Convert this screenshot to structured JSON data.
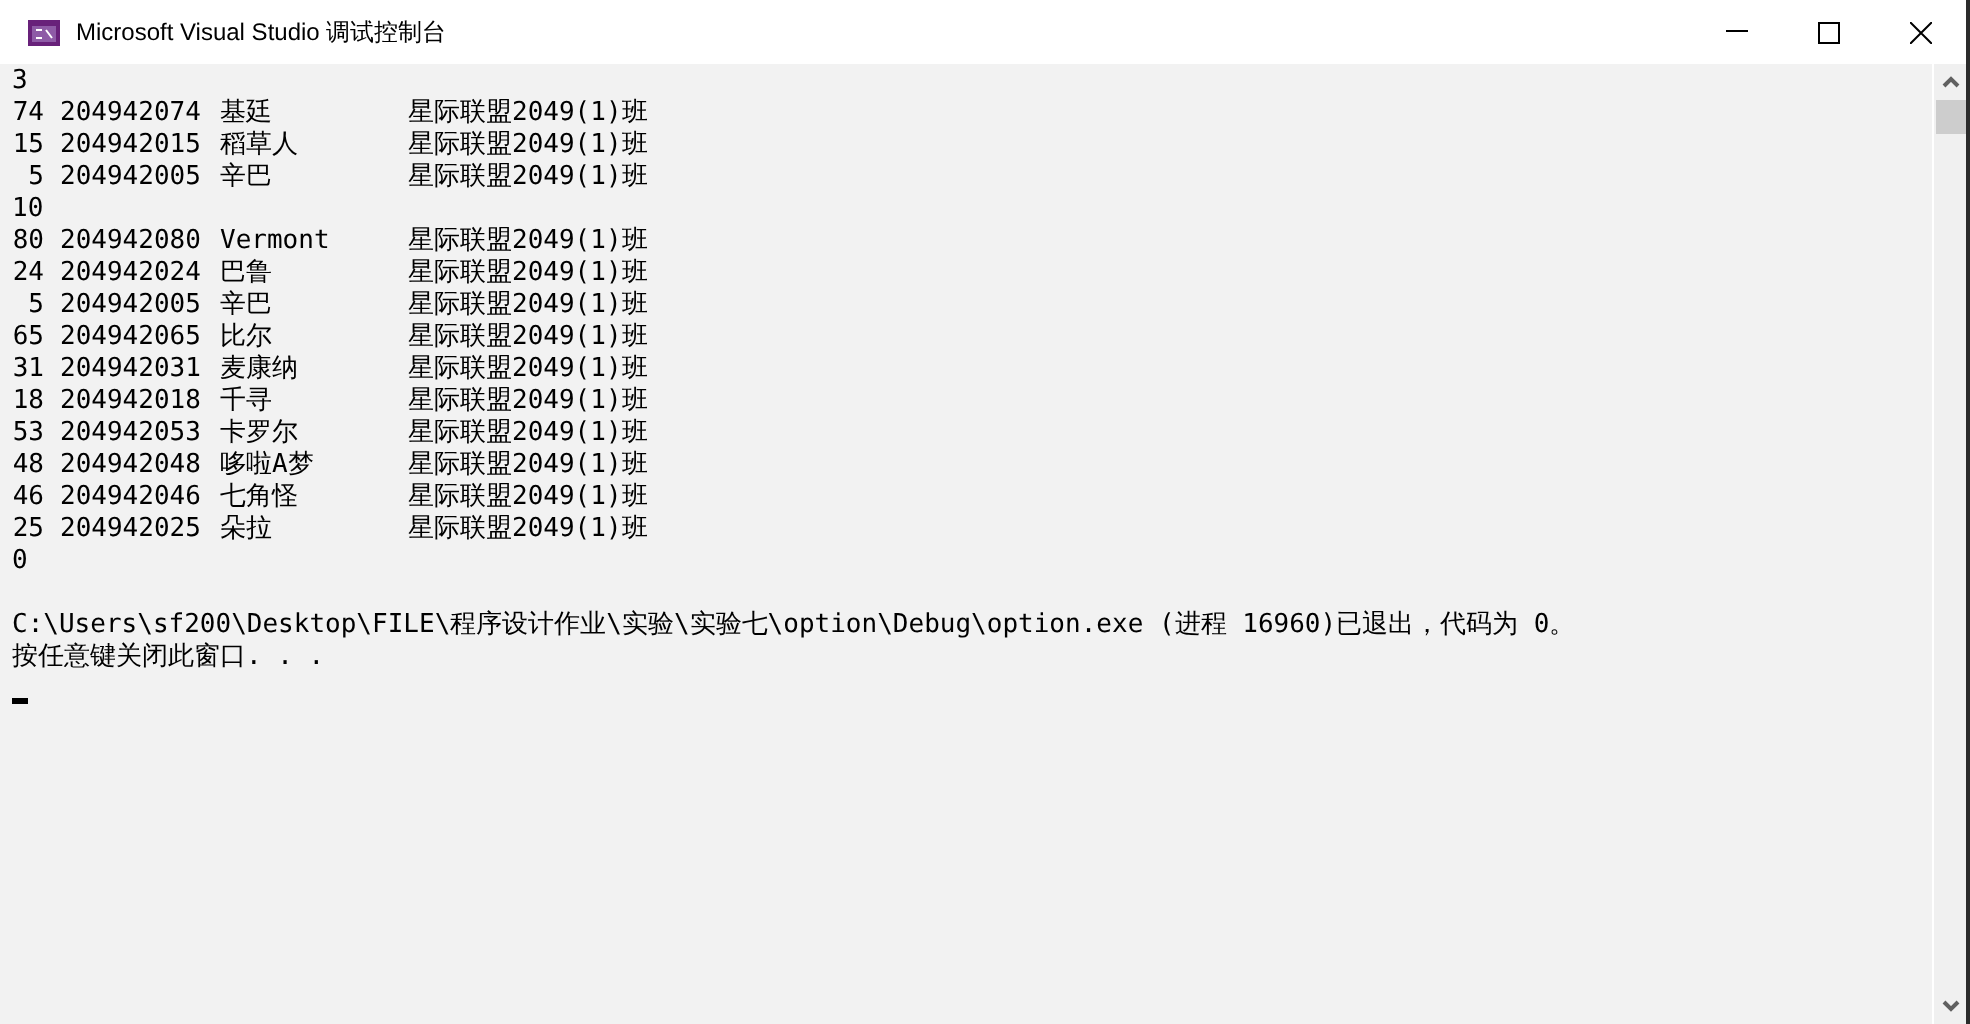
{
  "window": {
    "title": "Microsoft Visual Studio 调试控制台",
    "controls": [
      {
        "kind": "minimize"
      },
      {
        "kind": "maximize"
      },
      {
        "kind": "close"
      }
    ]
  },
  "console": {
    "lines": [
      {
        "kind": "text",
        "text": "3"
      },
      {
        "kind": "student",
        "rank": "74",
        "id": "204942074",
        "name": "基廷",
        "class": "星际联盟2049(1)班"
      },
      {
        "kind": "student",
        "rank": "15",
        "id": "204942015",
        "name": "稻草人",
        "class": "星际联盟2049(1)班"
      },
      {
        "kind": "student",
        "rank": "5",
        "id": "204942005",
        "name": "辛巴",
        "class": "星际联盟2049(1)班"
      },
      {
        "kind": "text",
        "text": "10"
      },
      {
        "kind": "student",
        "rank": "80",
        "id": "204942080",
        "name": "Vermont",
        "class": "星际联盟2049(1)班"
      },
      {
        "kind": "student",
        "rank": "24",
        "id": "204942024",
        "name": "巴鲁",
        "class": "星际联盟2049(1)班"
      },
      {
        "kind": "student",
        "rank": "5",
        "id": "204942005",
        "name": "辛巴",
        "class": "星际联盟2049(1)班"
      },
      {
        "kind": "student",
        "rank": "65",
        "id": "204942065",
        "name": "比尔",
        "class": "星际联盟2049(1)班"
      },
      {
        "kind": "student",
        "rank": "31",
        "id": "204942031",
        "name": "麦康纳",
        "class": "星际联盟2049(1)班"
      },
      {
        "kind": "student",
        "rank": "18",
        "id": "204942018",
        "name": "千寻",
        "class": "星际联盟2049(1)班"
      },
      {
        "kind": "student",
        "rank": "53",
        "id": "204942053",
        "name": "卡罗尔",
        "class": "星际联盟2049(1)班"
      },
      {
        "kind": "student",
        "rank": "48",
        "id": "204942048",
        "name": "哆啦A梦",
        "class": "星际联盟2049(1)班"
      },
      {
        "kind": "student",
        "rank": "46",
        "id": "204942046",
        "name": "七角怪",
        "class": "星际联盟2049(1)班"
      },
      {
        "kind": "student",
        "rank": "25",
        "id": "204942025",
        "name": "朵拉",
        "class": "星际联盟2049(1)班"
      },
      {
        "kind": "text",
        "text": "0"
      },
      {
        "kind": "blank"
      },
      {
        "kind": "text",
        "text": "C:\\Users\\sf200\\Desktop\\FILE\\程序设计作业\\实验\\实验七\\option\\Debug\\option.exe (进程 16960)已退出，代码为 0。"
      },
      {
        "kind": "text",
        "text": "按任意键关闭此窗口. . ."
      },
      {
        "kind": "cursor"
      }
    ]
  }
}
